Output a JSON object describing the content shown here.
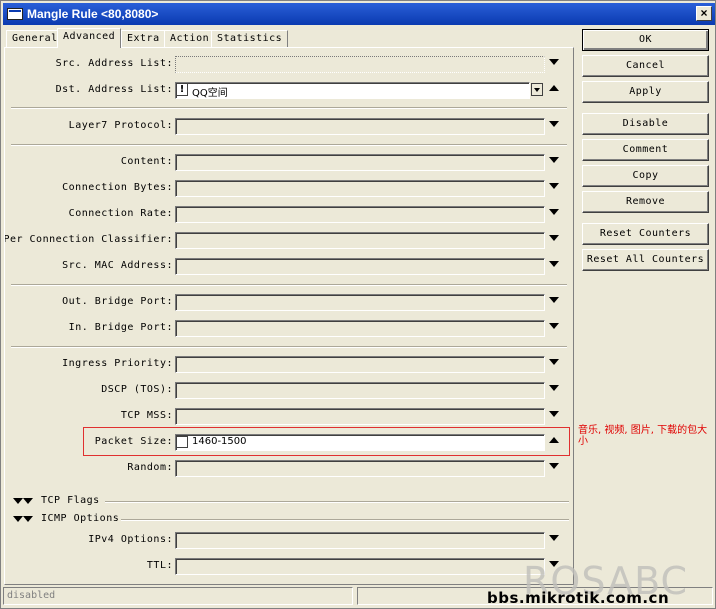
{
  "window": {
    "title": "Mangle Rule <80,8080>",
    "close_glyph": "×"
  },
  "tabs": [
    {
      "label": "General",
      "active": false
    },
    {
      "label": "Advanced",
      "active": true
    },
    {
      "label": "Extra",
      "active": false
    },
    {
      "label": "Action",
      "active": false
    },
    {
      "label": "Statistics",
      "active": false
    }
  ],
  "fields": {
    "src_address_list": {
      "label": "Src. Address List:",
      "value": ""
    },
    "dst_address_list": {
      "label": "Dst. Address List:",
      "value": "QQ空间",
      "negate": "!"
    },
    "layer7_protocol": {
      "label": "Layer7 Protocol:",
      "value": ""
    },
    "content": {
      "label": "Content:",
      "value": ""
    },
    "connection_bytes": {
      "label": "Connection Bytes:",
      "value": ""
    },
    "connection_rate": {
      "label": "Connection Rate:",
      "value": ""
    },
    "per_connection_classifier": {
      "label": "Per Connection Classifier:",
      "value": ""
    },
    "src_mac_address": {
      "label": "Src. MAC Address:",
      "value": ""
    },
    "out_bridge_port": {
      "label": "Out. Bridge Port:",
      "value": ""
    },
    "in_bridge_port": {
      "label": "In. Bridge Port:",
      "value": ""
    },
    "ingress_priority": {
      "label": "Ingress Priority:",
      "value": ""
    },
    "dscp": {
      "label": "DSCP (TOS):",
      "value": ""
    },
    "tcp_mss": {
      "label": "TCP MSS:",
      "value": ""
    },
    "packet_size": {
      "label": "Packet Size:",
      "value": "1460-1500"
    },
    "random": {
      "label": "Random:",
      "value": ""
    },
    "ipv4_options": {
      "label": "IPv4 Options:",
      "value": ""
    },
    "ttl": {
      "label": "TTL:",
      "value": ""
    }
  },
  "sections": {
    "tcp_flags": "TCP Flags",
    "icmp_options": "ICMP Options"
  },
  "annotation": {
    "text": "音乐, 视频, 图片, 下载的包大小",
    "color": "#e00000"
  },
  "buttons": {
    "ok": "OK",
    "cancel": "Cancel",
    "apply": "Apply",
    "disable": "Disable",
    "comment": "Comment",
    "copy": "Copy",
    "remove": "Remove",
    "reset_counters": "Reset Counters",
    "reset_all_counters": "Reset All Counters"
  },
  "status": {
    "state": "disabled"
  },
  "watermark": {
    "logo": "ROSABC",
    "url": "bbs.mikrotik.com.cn"
  },
  "colors": {
    "titlebar": "#0a3ab0",
    "highlight_border": "#e03030",
    "window_bg": "#ece9d8"
  }
}
